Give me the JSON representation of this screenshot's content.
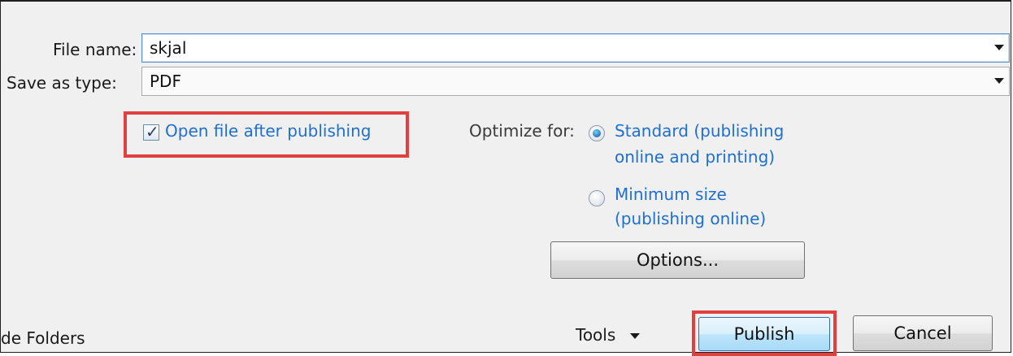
{
  "file_name": {
    "label": "File name:",
    "value": "skjal"
  },
  "save_as_type": {
    "label": "Save as type:",
    "value": "PDF"
  },
  "open_after_publishing": {
    "label": "Open file after publishing",
    "checked": true
  },
  "optimize": {
    "label": "Optimize for:",
    "options": [
      {
        "line1": "Standard (publishing",
        "line2": "online and printing)",
        "selected": true
      },
      {
        "line1": "Minimum size",
        "line2": "(publishing online)",
        "selected": false
      }
    ]
  },
  "buttons": {
    "options": "Options...",
    "tools": "Tools",
    "publish": "Publish",
    "cancel": "Cancel"
  },
  "hide_folders": "de Folders",
  "colors": {
    "highlight": "#e2403f",
    "link_blue": "#1f6fd1"
  }
}
